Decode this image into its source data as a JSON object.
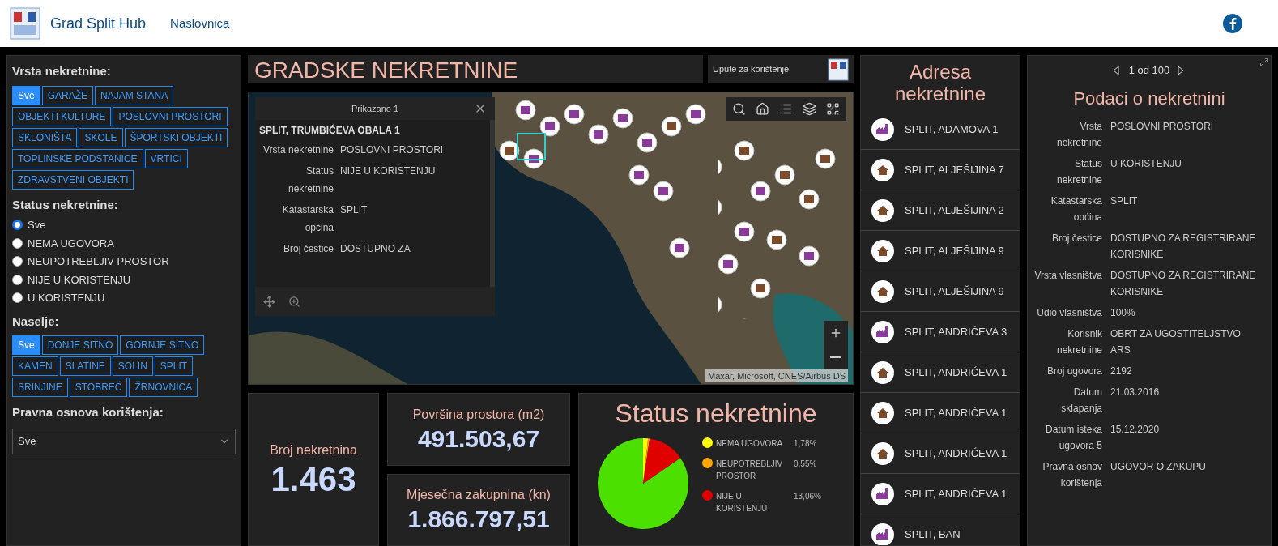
{
  "header": {
    "title": "Grad Split Hub",
    "nav": [
      {
        "label": "Naslovnica",
        "selected": false
      }
    ]
  },
  "filters": {
    "type_label": "Vrsta nekretnine:",
    "types": [
      {
        "label": "Sve",
        "selected": true
      },
      {
        "label": "GARAŽE",
        "selected": false
      },
      {
        "label": "NAJAM STANA",
        "selected": false
      },
      {
        "label": "OBJEKTI KULTURE",
        "selected": false
      },
      {
        "label": "POSLOVNI PROSTORI",
        "selected": false
      },
      {
        "label": "SKLONIŠTA",
        "selected": false
      },
      {
        "label": "SKOLE",
        "selected": false
      },
      {
        "label": "ŠPORTSKI OBJEKTI",
        "selected": false
      },
      {
        "label": "TOPLINSKE PODSTANICE",
        "selected": false
      },
      {
        "label": "VRTICI",
        "selected": false
      },
      {
        "label": "ZDRAVSTVENI OBJEKTI",
        "selected": false
      }
    ],
    "status_label": "Status nekretnine:",
    "statuses": [
      {
        "label": "Sve",
        "selected": true
      },
      {
        "label": "NEMA UGOVORA",
        "selected": false
      },
      {
        "label": "NEUPOTREBLJIV PROSTOR",
        "selected": false
      },
      {
        "label": "NIJE U KORISTENJU",
        "selected": false
      },
      {
        "label": "U KORISTENJU",
        "selected": false
      }
    ],
    "settlement_label": "Naselje:",
    "settlements": [
      {
        "label": "Sve",
        "selected": true
      },
      {
        "label": "DONJE SITNO",
        "selected": false
      },
      {
        "label": "GORNJE SITNO",
        "selected": false
      },
      {
        "label": "KAMEN",
        "selected": false
      },
      {
        "label": "SLATINE",
        "selected": false
      },
      {
        "label": "SOLIN",
        "selected": false
      },
      {
        "label": "SPLIT",
        "selected": false
      },
      {
        "label": "SRINJINE",
        "selected": false
      },
      {
        "label": "STOBREČ",
        "selected": false
      },
      {
        "label": "ŽRNOVNICA",
        "selected": false
      }
    ],
    "legal_label": "Pravna osnova korištenja:",
    "legal_value": "Sve"
  },
  "title_panel": {
    "title": "GRADSKE NEKRETNINE",
    "link": "Upute za korištenje"
  },
  "map": {
    "popup": {
      "title": "Prikazano 1",
      "heading": "SPLIT, TRUMBIĆEVA OBALA 1",
      "fields": [
        {
          "label": "Vrsta nekretnine",
          "value": "POSLOVNI PROSTORI"
        },
        {
          "label": "Status nekretnine",
          "value": "NIJE U KORISTENJU"
        },
        {
          "label": "Katastarska općina",
          "value": "SPLIT"
        },
        {
          "label": "Broj čestice",
          "value": "DOSTUPNO ZA"
        }
      ]
    },
    "attribution": "Maxar, Microsoft, CNES/Airbus DS"
  },
  "stats": [
    {
      "label": "Broj nekretnina",
      "value": "1.463"
    },
    {
      "label": "Površina prostora (m2)",
      "value": "491.503,67"
    },
    {
      "label": "Mjesečna zakupnina (kn)",
      "value": "1.866.797,51"
    }
  ],
  "status_chart": {
    "title": "Status nekretnine",
    "legend": [
      {
        "label": "NEMA UGOVORA",
        "value": "1,78%",
        "color": "#ffff00"
      },
      {
        "label": "NEUPOTREBLJIV PROSTOR",
        "value": "0,55%",
        "color": "#ffa500"
      },
      {
        "label": "NIJE U KORISTENJU",
        "value": "13,06%",
        "color": "#e00000"
      }
    ]
  },
  "addresses": {
    "title": "Adresa nekretnine",
    "items": [
      {
        "label": "SPLIT, ADAMOVA 1",
        "kind": "factory"
      },
      {
        "label": "SPLIT, ALJEŠIJINA 7",
        "kind": "house"
      },
      {
        "label": "SPLIT, ALJEŠIJINA 2",
        "kind": "house"
      },
      {
        "label": "SPLIT, ALJEŠIJINA 9",
        "kind": "house"
      },
      {
        "label": "SPLIT, ALJEŠIJINA 9",
        "kind": "house"
      },
      {
        "label": "SPLIT, ANDRIĆEVA 3",
        "kind": "factory"
      },
      {
        "label": "SPLIT, ANDRIĆEVA 1",
        "kind": "house"
      },
      {
        "label": "SPLIT, ANDRIĆEVA 1",
        "kind": "house"
      },
      {
        "label": "SPLIT, ANDRIĆEVA 1",
        "kind": "house"
      },
      {
        "label": "SPLIT, ANDRIĆEVA 1",
        "kind": "factory"
      },
      {
        "label": "SPLIT, BAN",
        "kind": "factory"
      }
    ]
  },
  "details": {
    "pager": "1 od 100",
    "title": "Podaci o nekretnini",
    "fields": [
      {
        "label": "Vrsta nekretnine",
        "value": "POSLOVNI PROSTORI"
      },
      {
        "label": "Status nekretnine",
        "value": "U KORISTENJU"
      },
      {
        "label": "Katastarska općina",
        "value": "SPLIT"
      },
      {
        "label": "Broj čestice",
        "value": "DOSTUPNO ZA REGISTRIRANE KORISNIKE"
      },
      {
        "label": "Vrsta vlasništva",
        "value": "DOSTUPNO ZA REGISTRIRANE KORISNIKE"
      },
      {
        "label": "Udio vlasništva",
        "value": "100%"
      },
      {
        "label": "Korisnik nekretnine",
        "value": "OBRT ZA UGOSTITELJSTVO ARS"
      },
      {
        "label": "Broj ugovora",
        "value": "2192"
      },
      {
        "label": "Datum sklapanja",
        "value": "21.03.2016"
      },
      {
        "label": "Datum isteka ugovora 5",
        "value": "15.12.2020"
      },
      {
        "label": "Pravna osnov korištenja",
        "value": "UGOVOR O ZAKUPU"
      }
    ]
  }
}
